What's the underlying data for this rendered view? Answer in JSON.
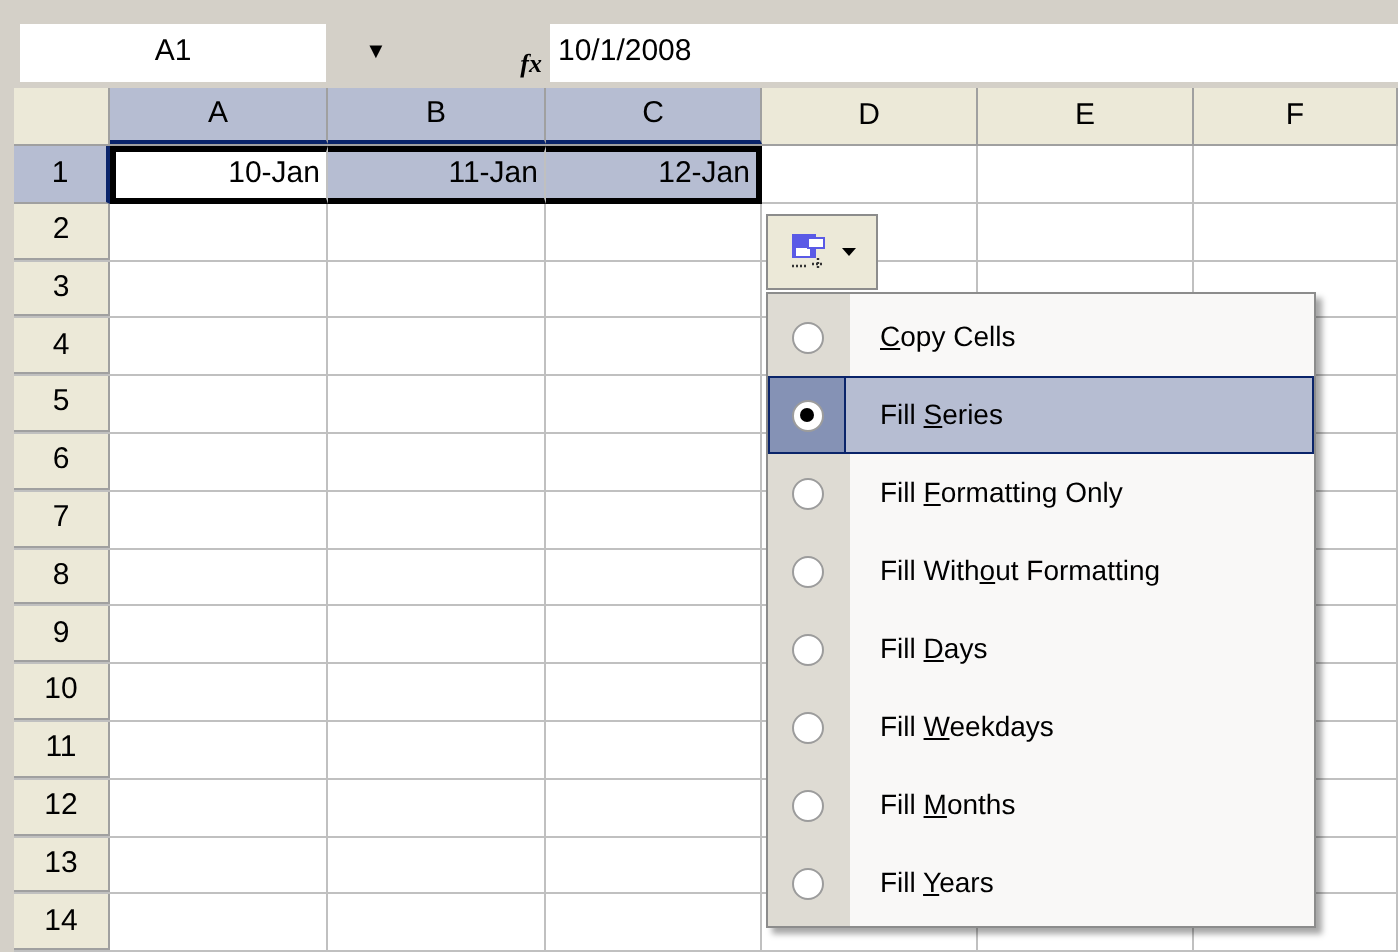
{
  "name_box": {
    "value": "A1",
    "arrow": "▼"
  },
  "formula_bar": {
    "icon": "fx",
    "value": "10/1/2008"
  },
  "columns": [
    {
      "label": "A",
      "selected": true
    },
    {
      "label": "B",
      "selected": true
    },
    {
      "label": "C",
      "selected": true
    },
    {
      "label": "D",
      "selected": false
    },
    {
      "label": "E",
      "selected": false
    },
    {
      "label": "F",
      "selected": false
    }
  ],
  "rows": [
    {
      "header": "1",
      "selected": true,
      "cells": [
        {
          "text": "10-Jan",
          "selected": true,
          "active": true
        },
        {
          "text": "11-Jan",
          "selected": true,
          "active": false
        },
        {
          "text": "12-Jan",
          "selected": true,
          "active": false
        }
      ]
    },
    {
      "header": "2",
      "selected": false
    },
    {
      "header": "3",
      "selected": false
    },
    {
      "header": "4",
      "selected": false
    },
    {
      "header": "5",
      "selected": false
    },
    {
      "header": "6",
      "selected": false
    },
    {
      "header": "7",
      "selected": false
    },
    {
      "header": "8",
      "selected": false
    },
    {
      "header": "9",
      "selected": false
    },
    {
      "header": "10",
      "selected": false
    },
    {
      "header": "11",
      "selected": false
    },
    {
      "header": "12",
      "selected": false
    },
    {
      "header": "13",
      "selected": false
    },
    {
      "header": "14",
      "selected": false
    }
  ],
  "autofill_menu": {
    "items": [
      {
        "label": {
          "key": "C",
          "after": "opy Cells"
        },
        "selected": false,
        "highlighted": false
      },
      {
        "label": {
          "before": "Fill ",
          "key": "S",
          "after": "eries"
        },
        "selected": true,
        "highlighted": true
      },
      {
        "label": {
          "before": "Fill ",
          "key": "F",
          "after": "ormatting Only"
        },
        "selected": false,
        "highlighted": false
      },
      {
        "label": {
          "before": "Fill With",
          "key": "o",
          "after": "ut Formatting"
        },
        "selected": false,
        "highlighted": false
      },
      {
        "label": {
          "before": "Fill ",
          "key": "D",
          "after": "ays"
        },
        "selected": false,
        "highlighted": false
      },
      {
        "label": {
          "before": "Fill ",
          "key": "W",
          "after": "eekdays"
        },
        "selected": false,
        "highlighted": false
      },
      {
        "label": {
          "before": "Fill ",
          "key": "M",
          "after": "onths"
        },
        "selected": false,
        "highlighted": false
      },
      {
        "label": {
          "before": "Fill ",
          "key": "Y",
          "after": "ears"
        },
        "selected": false,
        "highlighted": false
      }
    ]
  }
}
